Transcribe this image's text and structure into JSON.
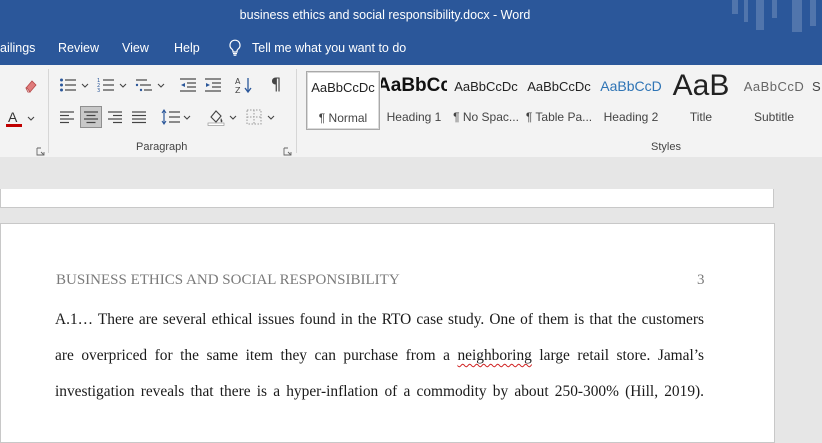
{
  "window": {
    "title": "business ethics and social responsibility.docx  -  Word"
  },
  "menu": {
    "items": [
      {
        "label": "ailings",
        "name": "menu-mailings"
      },
      {
        "label": "Review",
        "name": "menu-review"
      },
      {
        "label": "View",
        "name": "menu-view"
      },
      {
        "label": "Help",
        "name": "menu-help"
      }
    ],
    "tell_me": "Tell me what you want to do"
  },
  "ribbon": {
    "paragraph_group_label": "Paragraph",
    "styles_group_label": "Styles",
    "styles": [
      {
        "sample": "AaBbCcDc",
        "label": "¶ Normal",
        "selected": true
      },
      {
        "sample": "AaBbCc",
        "label": "Heading 1"
      },
      {
        "sample": "AaBbCcDc",
        "label": "¶ No Spac..."
      },
      {
        "sample": "AaBbCcDc",
        "label": "¶ Table Pa..."
      },
      {
        "sample": "AaBbCcD",
        "label": "Heading 2"
      },
      {
        "sample": "AaB",
        "label": "Title"
      },
      {
        "sample": "AaBbCcD",
        "label": "Subtitle"
      }
    ]
  },
  "document": {
    "running_head": "BUSINESS ETHICS AND SOCIAL RESPONSIBILITY",
    "page_number": "3",
    "lines": [
      {
        "text": "A.1… There are several ethical issues found in the RTO case study. One of them is that the customers"
      },
      {
        "before": "are overpriced for the same item they can purchase from a ",
        "misspelled": "neighboring",
        "after": " large retail store. Jamal’s"
      },
      {
        "text": "investigation reveals that there is a hyper-inflation of a commodity by about 250-300% (Hill, 2019)."
      }
    ]
  },
  "colors": {
    "title_bar": "#2b579a",
    "ribbon": "#f3f3f3",
    "document_background": "#e6e6e6",
    "heading2_sample": "#2e74b5",
    "font_color_accent": "#c00000"
  }
}
